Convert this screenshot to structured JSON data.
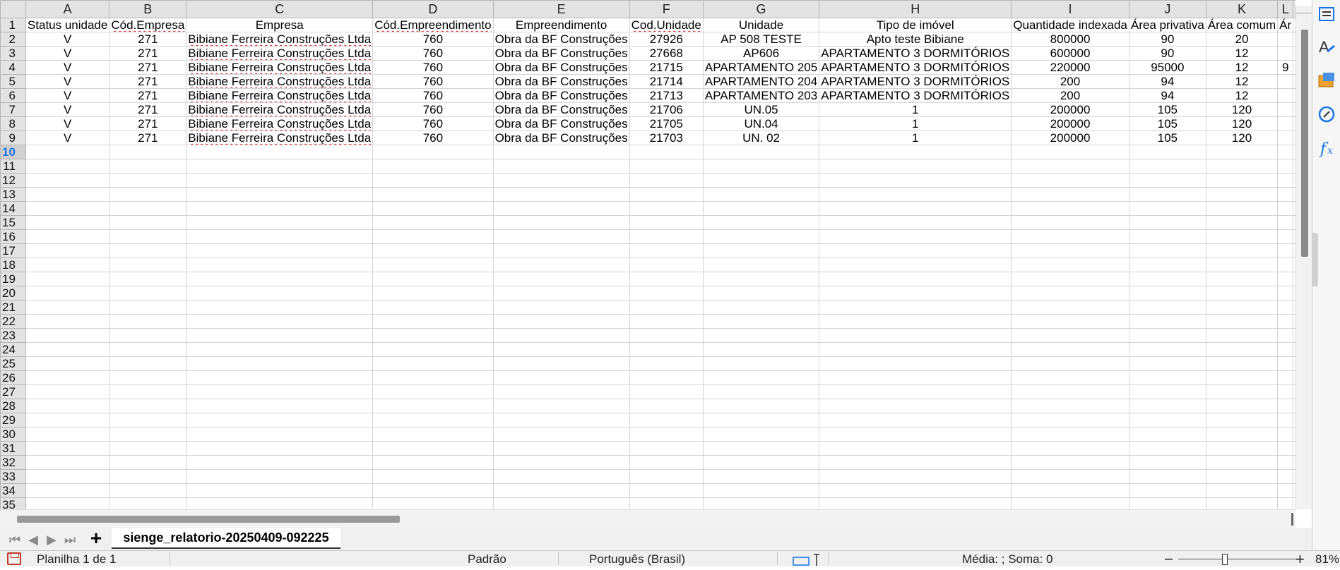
{
  "columns": [
    "A",
    "B",
    "C",
    "D",
    "E",
    "F",
    "G",
    "H",
    "I",
    "J",
    "K",
    "L"
  ],
  "headers": [
    "Status unidade",
    "Cód.Empresa",
    "Empresa",
    "Cód.Empreendimento",
    "Empreendimento",
    "Cod.Unidade",
    "Unidade",
    "Tipo de imóvel",
    "Quantidade indexada",
    "Área privativa",
    "Área comum",
    "Ár"
  ],
  "rows": [
    [
      "V",
      "271",
      "Bibiane Ferreira Construções Ltda",
      "760",
      "Obra da BF Construções",
      "27926",
      "AP 508 TESTE",
      "Apto teste Bibiane",
      "800000",
      "90",
      "20",
      ""
    ],
    [
      "V",
      "271",
      "Bibiane Ferreira Construções Ltda",
      "760",
      "Obra da BF Construções",
      "27668",
      "AP606",
      "APARTAMENTO 3 DORMITÓRIOS",
      "600000",
      "90",
      "12",
      ""
    ],
    [
      "V",
      "271",
      "Bibiane Ferreira Construções Ltda",
      "760",
      "Obra da BF Construções",
      "21715",
      "APARTAMENTO 205",
      "APARTAMENTO 3 DORMITÓRIOS",
      "220000",
      "95000",
      "12",
      "9"
    ],
    [
      "V",
      "271",
      "Bibiane Ferreira Construções Ltda",
      "760",
      "Obra da BF Construções",
      "21714",
      "APARTAMENTO 204",
      "APARTAMENTO 3 DORMITÓRIOS",
      "200",
      "94",
      "12",
      ""
    ],
    [
      "V",
      "271",
      "Bibiane Ferreira Construções Ltda",
      "760",
      "Obra da BF Construções",
      "21713",
      "APARTAMENTO 203",
      "APARTAMENTO 3 DORMITÓRIOS",
      "200",
      "94",
      "12",
      ""
    ],
    [
      "V",
      "271",
      "Bibiane Ferreira Construções Ltda",
      "760",
      "Obra da BF Construções",
      "21706",
      "UN.05",
      "1",
      "200000",
      "105",
      "120",
      ""
    ],
    [
      "V",
      "271",
      "Bibiane Ferreira Construções Ltda",
      "760",
      "Obra da BF Construções",
      "21705",
      "UN.04",
      "1",
      "200000",
      "105",
      "120",
      ""
    ],
    [
      "V",
      "271",
      "Bibiane Ferreira Construções Ltda",
      "760",
      "Obra da BF Construções",
      "21703",
      "UN. 02",
      "1",
      "200000",
      "105",
      "120",
      ""
    ]
  ],
  "row_numbers": [
    "1",
    "2",
    "3",
    "4",
    "5",
    "6",
    "7",
    "8",
    "9",
    "10",
    "11",
    "12",
    "13",
    "14",
    "15",
    "16",
    "17",
    "18",
    "19",
    "20",
    "21",
    "22",
    "23",
    "24",
    "25",
    "26",
    "27",
    "28",
    "29",
    "30",
    "31",
    "32",
    "33",
    "34",
    "35"
  ],
  "active_row": "10",
  "sheet_tab": {
    "add_symbol": "+",
    "name": "sienge_relatorio-20250409-092225"
  },
  "nav": {
    "first": "⏮",
    "prev": "◀",
    "next": "▶",
    "last": "⏭"
  },
  "statusbar": {
    "sheet_info": "Planilha 1 de 1",
    "page_style": "Padrão",
    "language": "Português (Brasil)",
    "sum_info": "Média: ; Soma: 0",
    "zoom_minus": "−",
    "zoom_plus": "+",
    "zoom_level": "81%"
  },
  "sidebar_icons": [
    "properties-icon",
    "styles-icon",
    "gallery-icon",
    "navigator-icon",
    "functions-icon"
  ],
  "colors": {
    "accent": "#1a73e8",
    "header_bg": "#e3e3e3",
    "spell_underline": "#e01b1b"
  }
}
